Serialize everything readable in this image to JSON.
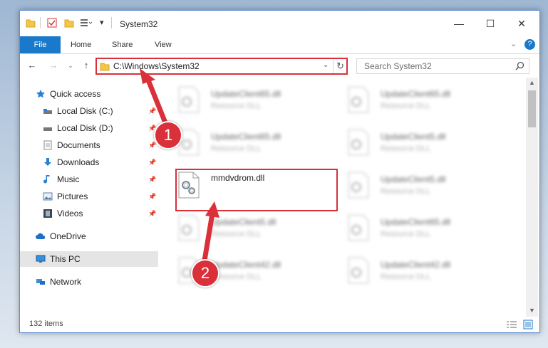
{
  "window": {
    "title": "System32"
  },
  "ribbon": {
    "tabs": [
      {
        "label": "File",
        "active": true
      },
      {
        "label": "Home"
      },
      {
        "label": "Share"
      },
      {
        "label": "View"
      }
    ]
  },
  "nav": {
    "address": "C:\\Windows\\System32",
    "search_placeholder": "Search System32"
  },
  "sidebar": {
    "items": [
      {
        "label": "Quick access",
        "icon": "star-icon"
      },
      {
        "label": "Local Disk (C:)",
        "icon": "drive-icon",
        "pinned": true
      },
      {
        "label": "Local Disk (D:)",
        "icon": "drive-icon",
        "pinned": true
      },
      {
        "label": "Documents",
        "icon": "documents-icon",
        "pinned": true
      },
      {
        "label": "Downloads",
        "icon": "downloads-icon",
        "pinned": true
      },
      {
        "label": "Music",
        "icon": "music-icon",
        "pinned": true
      },
      {
        "label": "Pictures",
        "icon": "pictures-icon",
        "pinned": true
      },
      {
        "label": "Videos",
        "icon": "videos-icon",
        "pinned": true
      },
      {
        "label": "OneDrive",
        "icon": "cloud-icon"
      },
      {
        "label": "This PC",
        "icon": "computer-icon",
        "selected": true
      },
      {
        "label": "Network",
        "icon": "network-icon"
      }
    ]
  },
  "files": {
    "left": [
      {
        "name": "UpdateClient65.dll",
        "type": "Resource DLL"
      },
      {
        "name": "UpdateClient65.dll",
        "type": "Resource DLL"
      },
      {
        "name": "mmdvdrom.dll",
        "type": ""
      },
      {
        "name": "UpdateClient5.dll",
        "type": "Resource DLL"
      },
      {
        "name": "UpdateClient42.dll",
        "type": "Resource DLL"
      }
    ],
    "right": [
      {
        "name": "UpdateClient65.dll",
        "type": "Resource DLL"
      },
      {
        "name": "UpdateClient5.dll",
        "type": "Resource DLL"
      },
      {
        "name": "UpdateClient5.dll",
        "type": "Resource DLL"
      },
      {
        "name": "UpdateClient65.dll",
        "type": "Resource DLL"
      },
      {
        "name": "UpdateClient42.dll",
        "type": "Resource DLL"
      }
    ]
  },
  "status": {
    "item_count": "132 items"
  },
  "annotations": {
    "step1": "1",
    "step2": "2",
    "color": "#d9303a"
  },
  "colors": {
    "accent": "#1979ca"
  }
}
